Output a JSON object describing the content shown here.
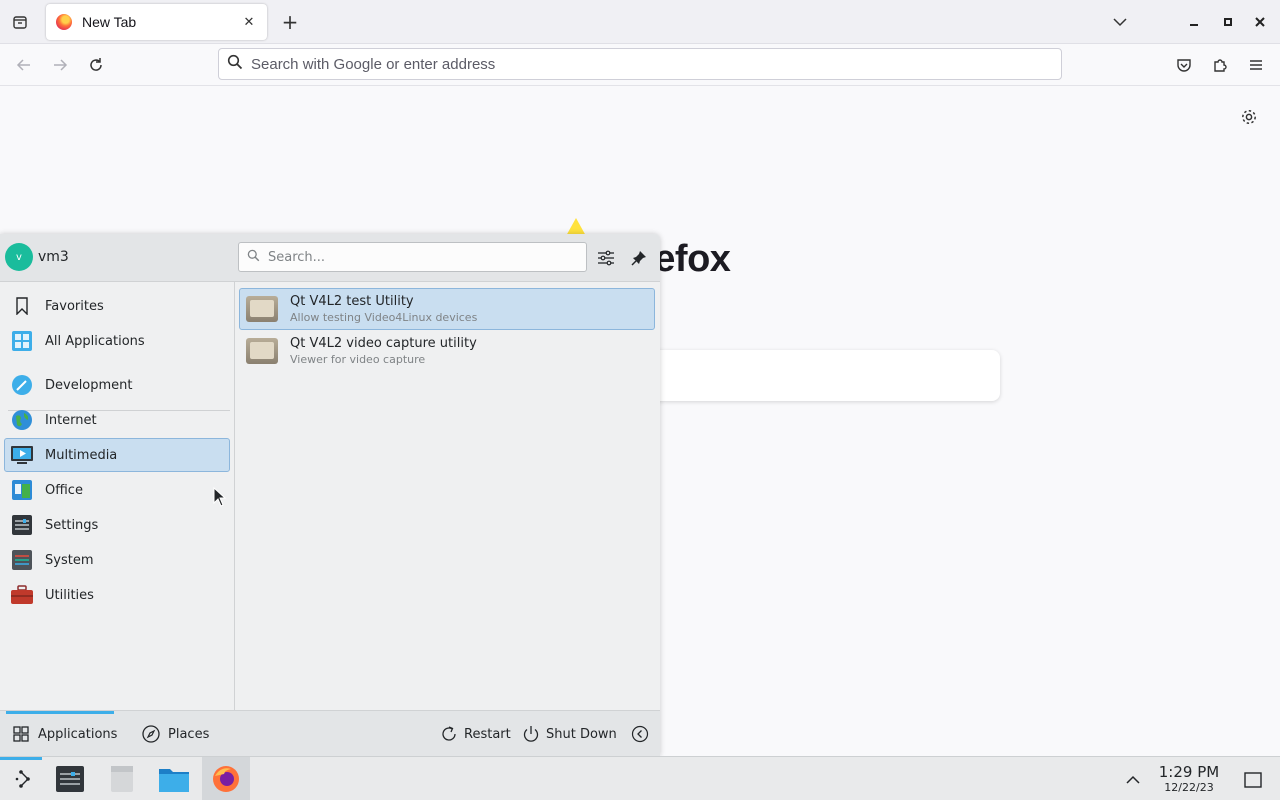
{
  "browser": {
    "tab": {
      "title": "New Tab"
    },
    "urlbar": {
      "placeholder": "Search with Google or enter address",
      "value": ""
    },
    "newtab_page": {
      "wordmark": "refox"
    }
  },
  "launcher": {
    "user": {
      "name": "vm3",
      "avatar_letter": "v"
    },
    "search": {
      "placeholder": "Search..."
    },
    "categories": [
      {
        "label": "Favorites",
        "icon": "bookmark-icon"
      },
      {
        "label": "All Applications",
        "icon": "all-apps-icon"
      },
      {
        "label": "Development",
        "icon": "development-icon"
      },
      {
        "label": "Internet",
        "icon": "internet-globe-icon"
      },
      {
        "label": "Multimedia",
        "icon": "multimedia-icon",
        "selected": true
      },
      {
        "label": "Office",
        "icon": "office-icon"
      },
      {
        "label": "Settings",
        "icon": "settings-icon"
      },
      {
        "label": "System",
        "icon": "system-icon"
      },
      {
        "label": "Utilities",
        "icon": "utilities-toolbox-icon"
      }
    ],
    "apps": [
      {
        "name": "Qt V4L2 test Utility",
        "description": "Allow testing Video4Linux devices",
        "selected": true
      },
      {
        "name": "Qt V4L2 video capture utility",
        "description": "Viewer for video capture"
      }
    ],
    "footer": {
      "applications_label": "Applications",
      "places_label": "Places",
      "restart_label": "Restart",
      "shutdown_label": "Shut Down"
    }
  },
  "taskbar": {
    "time": "1:29 PM",
    "date": "12/22/23"
  },
  "colors": {
    "accent": "#3daee9",
    "selection_bg": "#c9def0",
    "selection_border": "#8cb6dc"
  }
}
